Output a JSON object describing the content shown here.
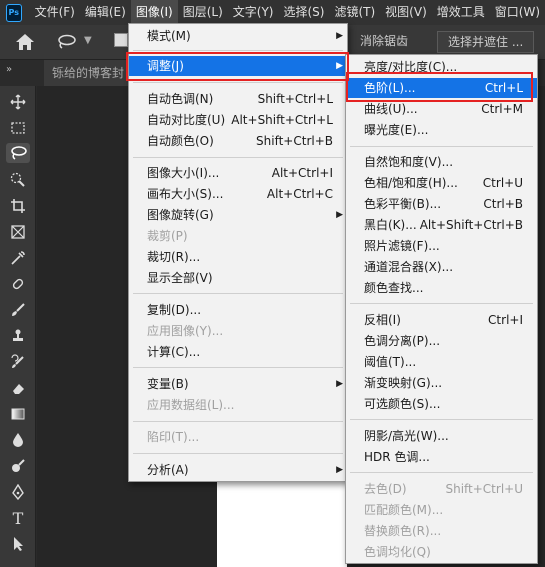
{
  "menubar": {
    "logo": "Ps",
    "items": [
      "文件(F)",
      "编辑(E)",
      "图像(I)",
      "图层(L)",
      "文字(Y)",
      "选择(S)",
      "滤镜(T)",
      "视图(V)",
      "增效工具",
      "窗口(W)"
    ]
  },
  "optbar": {
    "button_1": "消除锯齿",
    "button_2": "选择并遮住 ..."
  },
  "tab": {
    "doc_name": "铄给的博客封"
  },
  "image_menu": {
    "mode": "模式(M)",
    "adjust": "调整(J)",
    "auto_tone": "自动色调(N)",
    "auto_tone_sc": "Shift+Ctrl+L",
    "auto_contrast": "自动对比度(U)",
    "auto_contrast_sc": "Alt+Shift+Ctrl+L",
    "auto_color": "自动颜色(O)",
    "auto_color_sc": "Shift+Ctrl+B",
    "image_size": "图像大小(I)...",
    "image_size_sc": "Alt+Ctrl+I",
    "canvas_size": "画布大小(S)...",
    "canvas_size_sc": "Alt+Ctrl+C",
    "rotation": "图像旋转(G)",
    "crop": "裁剪(P)",
    "trim": "裁切(R)...",
    "reveal_all": "显示全部(V)",
    "duplicate": "复制(D)...",
    "apply_image": "应用图像(Y)...",
    "calculations": "计算(C)...",
    "variables": "变量(B)",
    "apply_data": "应用数据组(L)...",
    "trap": "陷印(T)...",
    "analysis": "分析(A)"
  },
  "adjust_menu": {
    "brightness": "亮度/对比度(C)...",
    "levels": "色阶(L)...",
    "levels_sc": "Ctrl+L",
    "curves": "曲线(U)...",
    "curves_sc": "Ctrl+M",
    "exposure": "曝光度(E)...",
    "vibrance": "自然饱和度(V)...",
    "hue_sat": "色相/饱和度(H)...",
    "hue_sat_sc": "Ctrl+U",
    "color_balance": "色彩平衡(B)...",
    "color_balance_sc": "Ctrl+B",
    "black_white": "黑白(K)...",
    "black_white_sc": "Alt+Shift+Ctrl+B",
    "photo_filter": "照片滤镜(F)...",
    "channel_mixer": "通道混合器(X)...",
    "color_lookup": "颜色查找...",
    "invert": "反相(I)",
    "invert_sc": "Ctrl+I",
    "posterize": "色调分离(P)...",
    "threshold": "阈值(T)...",
    "gradient_map": "渐变映射(G)...",
    "selective_color": "可选颜色(S)...",
    "shadows_highlights": "阴影/高光(W)...",
    "hdr_toning": "HDR 色调...",
    "desaturate": "去色(D)",
    "desaturate_sc": "Shift+Ctrl+U",
    "match_color": "匹配颜色(M)...",
    "replace_color": "替换颜色(R)...",
    "equalize": "色调均化(Q)"
  },
  "colors": {
    "highlight": "#1473e6",
    "annotation_red": "#e52222"
  }
}
